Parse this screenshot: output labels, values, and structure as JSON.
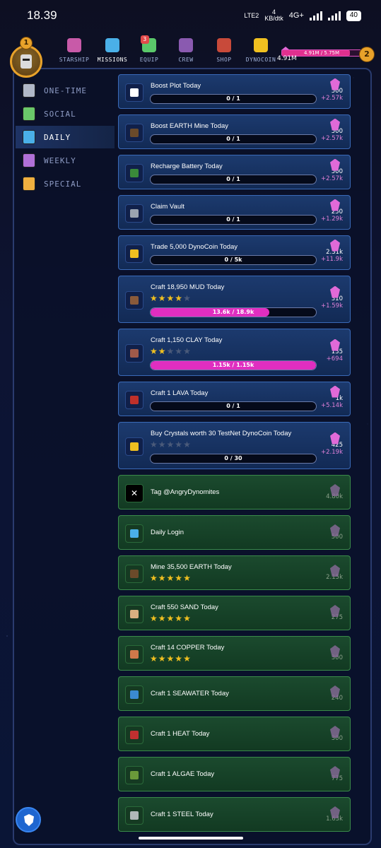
{
  "status_bar": {
    "time": "18.39",
    "network_label": "LTE2",
    "data_rate": "4",
    "data_unit": "KB/dtk",
    "network_type": "4G+",
    "battery": "40"
  },
  "player": {
    "level_left": "1",
    "level_right": "2",
    "crystals_total": "4.91M",
    "xp_text": "4.91M / 5.75M",
    "xp_fraction": 0.854
  },
  "nav": {
    "items": [
      {
        "label": "STARSHIP",
        "color": "#c85aa8"
      },
      {
        "label": "MISSIONS",
        "color": "#4ab0e8"
      },
      {
        "label": "EQUIP",
        "color": "#5ac86a",
        "badge": "3"
      },
      {
        "label": "CREW",
        "color": "#8a5ab0"
      },
      {
        "label": "SHOP",
        "color": "#c84a3a"
      },
      {
        "label": "DYNOCOIN",
        "color": "#f0c020"
      }
    ],
    "active": "MISSIONS"
  },
  "sidebar": {
    "items": [
      {
        "label": "ONE-TIME",
        "color": "#b0b8c8"
      },
      {
        "label": "SOCIAL",
        "color": "#6ac86a"
      },
      {
        "label": "DAILY",
        "color": "#4ab0e8"
      },
      {
        "label": "WEEKLY",
        "color": "#b070d8"
      },
      {
        "label": "SPECIAL",
        "color": "#f0b040"
      }
    ],
    "active": "DAILY"
  },
  "missions": [
    {
      "title": "Boost Plot Today",
      "progress_text": "0 / 1",
      "progress": 0,
      "reward": "500",
      "bonus": "+2.57k",
      "icon": "film-icon",
      "done": false
    },
    {
      "title": "Boost EARTH Mine Today",
      "progress_text": "0 / 1",
      "progress": 0,
      "reward": "500",
      "bonus": "+2.57k",
      "icon": "earth-mine-icon",
      "done": false
    },
    {
      "title": "Recharge Battery Today",
      "progress_text": "0 / 1",
      "progress": 0,
      "reward": "500",
      "bonus": "+2.57k",
      "icon": "battery-icon",
      "done": false
    },
    {
      "title": "Claim Vault",
      "progress_text": "0 / 1",
      "progress": 0,
      "reward": "250",
      "bonus": "+1.29k",
      "icon": "vault-icon",
      "done": false
    },
    {
      "title": "Trade 5,000 DynoCoin Today",
      "progress_text": "0 / 5k",
      "progress": 0,
      "reward": "2.31k",
      "bonus": "+11.9k",
      "icon": "dynocoin-icon",
      "done": false
    },
    {
      "title": "Craft 18,950 MUD Today",
      "stars": 4,
      "progress_text": "13.6k / 18.9k",
      "progress": 0.72,
      "reward": "310",
      "bonus": "+1.59k",
      "icon": "mud-icon",
      "done": false
    },
    {
      "title": "Craft 1,150 CLAY Today",
      "stars": 2,
      "progress_text": "1.15k / 1.15k",
      "progress": 1.0,
      "reward": "135",
      "bonus": "+694",
      "icon": "clay-icon",
      "done": false
    },
    {
      "title": "Craft 1 LAVA Today",
      "progress_text": "0 / 1",
      "progress": 0,
      "reward": "1k",
      "bonus": "+5.14k",
      "icon": "lava-icon",
      "done": false
    },
    {
      "title": "Buy Crystals worth 30 TestNet DynoCoin Today",
      "stars": 0,
      "progress_text": "0 / 30",
      "progress": 0,
      "reward": "425",
      "bonus": "+2.19k",
      "icon": "dynocoin-icon",
      "done": false
    },
    {
      "title": "Tag @AngryDynomites",
      "reward": "4.80k",
      "icon": "x-logo-icon",
      "done": true
    },
    {
      "title": "Daily Login",
      "reward": "500",
      "icon": "scroll-icon",
      "done": true
    },
    {
      "title": "Mine 35,500 EARTH Today",
      "stars": 5,
      "reward": "2.15k",
      "icon": "earth-icon",
      "done": true
    },
    {
      "title": "Craft 550 SAND Today",
      "stars": 5,
      "reward": "275",
      "icon": "sand-icon",
      "done": true
    },
    {
      "title": "Craft 14 COPPER Today",
      "stars": 5,
      "reward": "300",
      "icon": "copper-icon",
      "done": true
    },
    {
      "title": "Craft 1 SEAWATER Today",
      "reward": "240",
      "icon": "seawater-icon",
      "done": true
    },
    {
      "title": "Craft 1 HEAT Today",
      "reward": "300",
      "icon": "heat-icon",
      "done": true
    },
    {
      "title": "Craft 1 ALGAE Today",
      "reward": "775",
      "icon": "algae-icon",
      "done": true
    },
    {
      "title": "Craft 1 STEEL Today",
      "reward": "1.63k",
      "icon": "steel-icon",
      "done": true
    }
  ]
}
